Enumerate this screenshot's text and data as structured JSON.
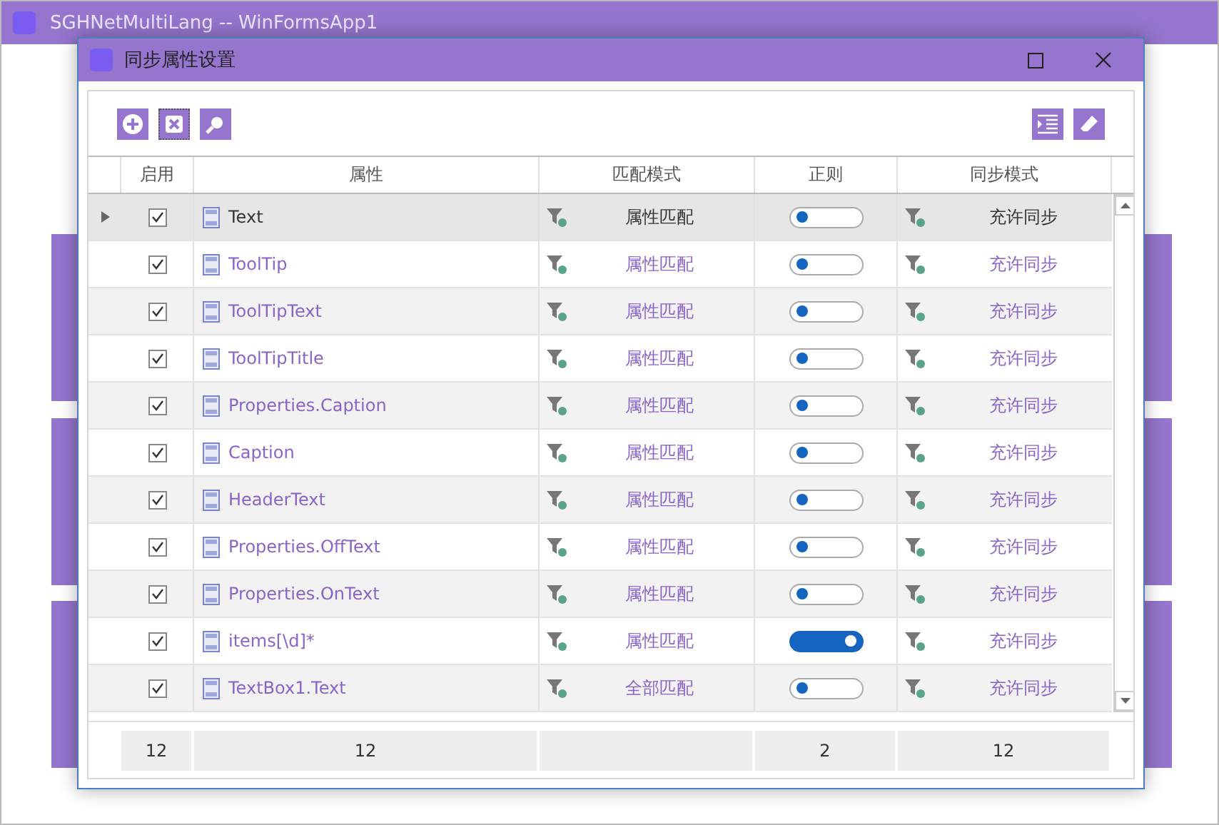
{
  "main_window": {
    "title": "SGHNetMultiLang -- WinFormsApp1"
  },
  "dialog": {
    "title": "同步属性设置"
  },
  "table": {
    "columns": [
      "启用",
      "属性",
      "匹配模式",
      "正则",
      "同步模式"
    ],
    "rows": [
      {
        "selected": true,
        "enabled": true,
        "property": "Text",
        "match_mode": "属性匹配",
        "regex": false,
        "sync_mode": "充许同步"
      },
      {
        "selected": false,
        "enabled": true,
        "property": "ToolTip",
        "match_mode": "属性匹配",
        "regex": false,
        "sync_mode": "充许同步"
      },
      {
        "selected": false,
        "enabled": true,
        "property": "ToolTipText",
        "match_mode": "属性匹配",
        "regex": false,
        "sync_mode": "充许同步"
      },
      {
        "selected": false,
        "enabled": true,
        "property": "ToolTipTitle",
        "match_mode": "属性匹配",
        "regex": false,
        "sync_mode": "充许同步"
      },
      {
        "selected": false,
        "enabled": true,
        "property": "Properties.Caption",
        "match_mode": "属性匹配",
        "regex": false,
        "sync_mode": "充许同步"
      },
      {
        "selected": false,
        "enabled": true,
        "property": "Caption",
        "match_mode": "属性匹配",
        "regex": false,
        "sync_mode": "充许同步"
      },
      {
        "selected": false,
        "enabled": true,
        "property": "HeaderText",
        "match_mode": "属性匹配",
        "regex": false,
        "sync_mode": "充许同步"
      },
      {
        "selected": false,
        "enabled": true,
        "property": "Properties.OffText",
        "match_mode": "属性匹配",
        "regex": false,
        "sync_mode": "充许同步"
      },
      {
        "selected": false,
        "enabled": true,
        "property": "Properties.OnText",
        "match_mode": "属性匹配",
        "regex": false,
        "sync_mode": "充许同步"
      },
      {
        "selected": false,
        "enabled": true,
        "property": "items[\\d]*",
        "match_mode": "属性匹配",
        "regex": true,
        "sync_mode": "充许同步"
      },
      {
        "selected": false,
        "enabled": true,
        "property": "TextBox1.Text",
        "match_mode": "全部匹配",
        "regex": false,
        "sync_mode": "充许同步"
      }
    ],
    "summary": {
      "enabled": "12",
      "property": "12",
      "regex": "2",
      "sync_mode": "12"
    }
  }
}
